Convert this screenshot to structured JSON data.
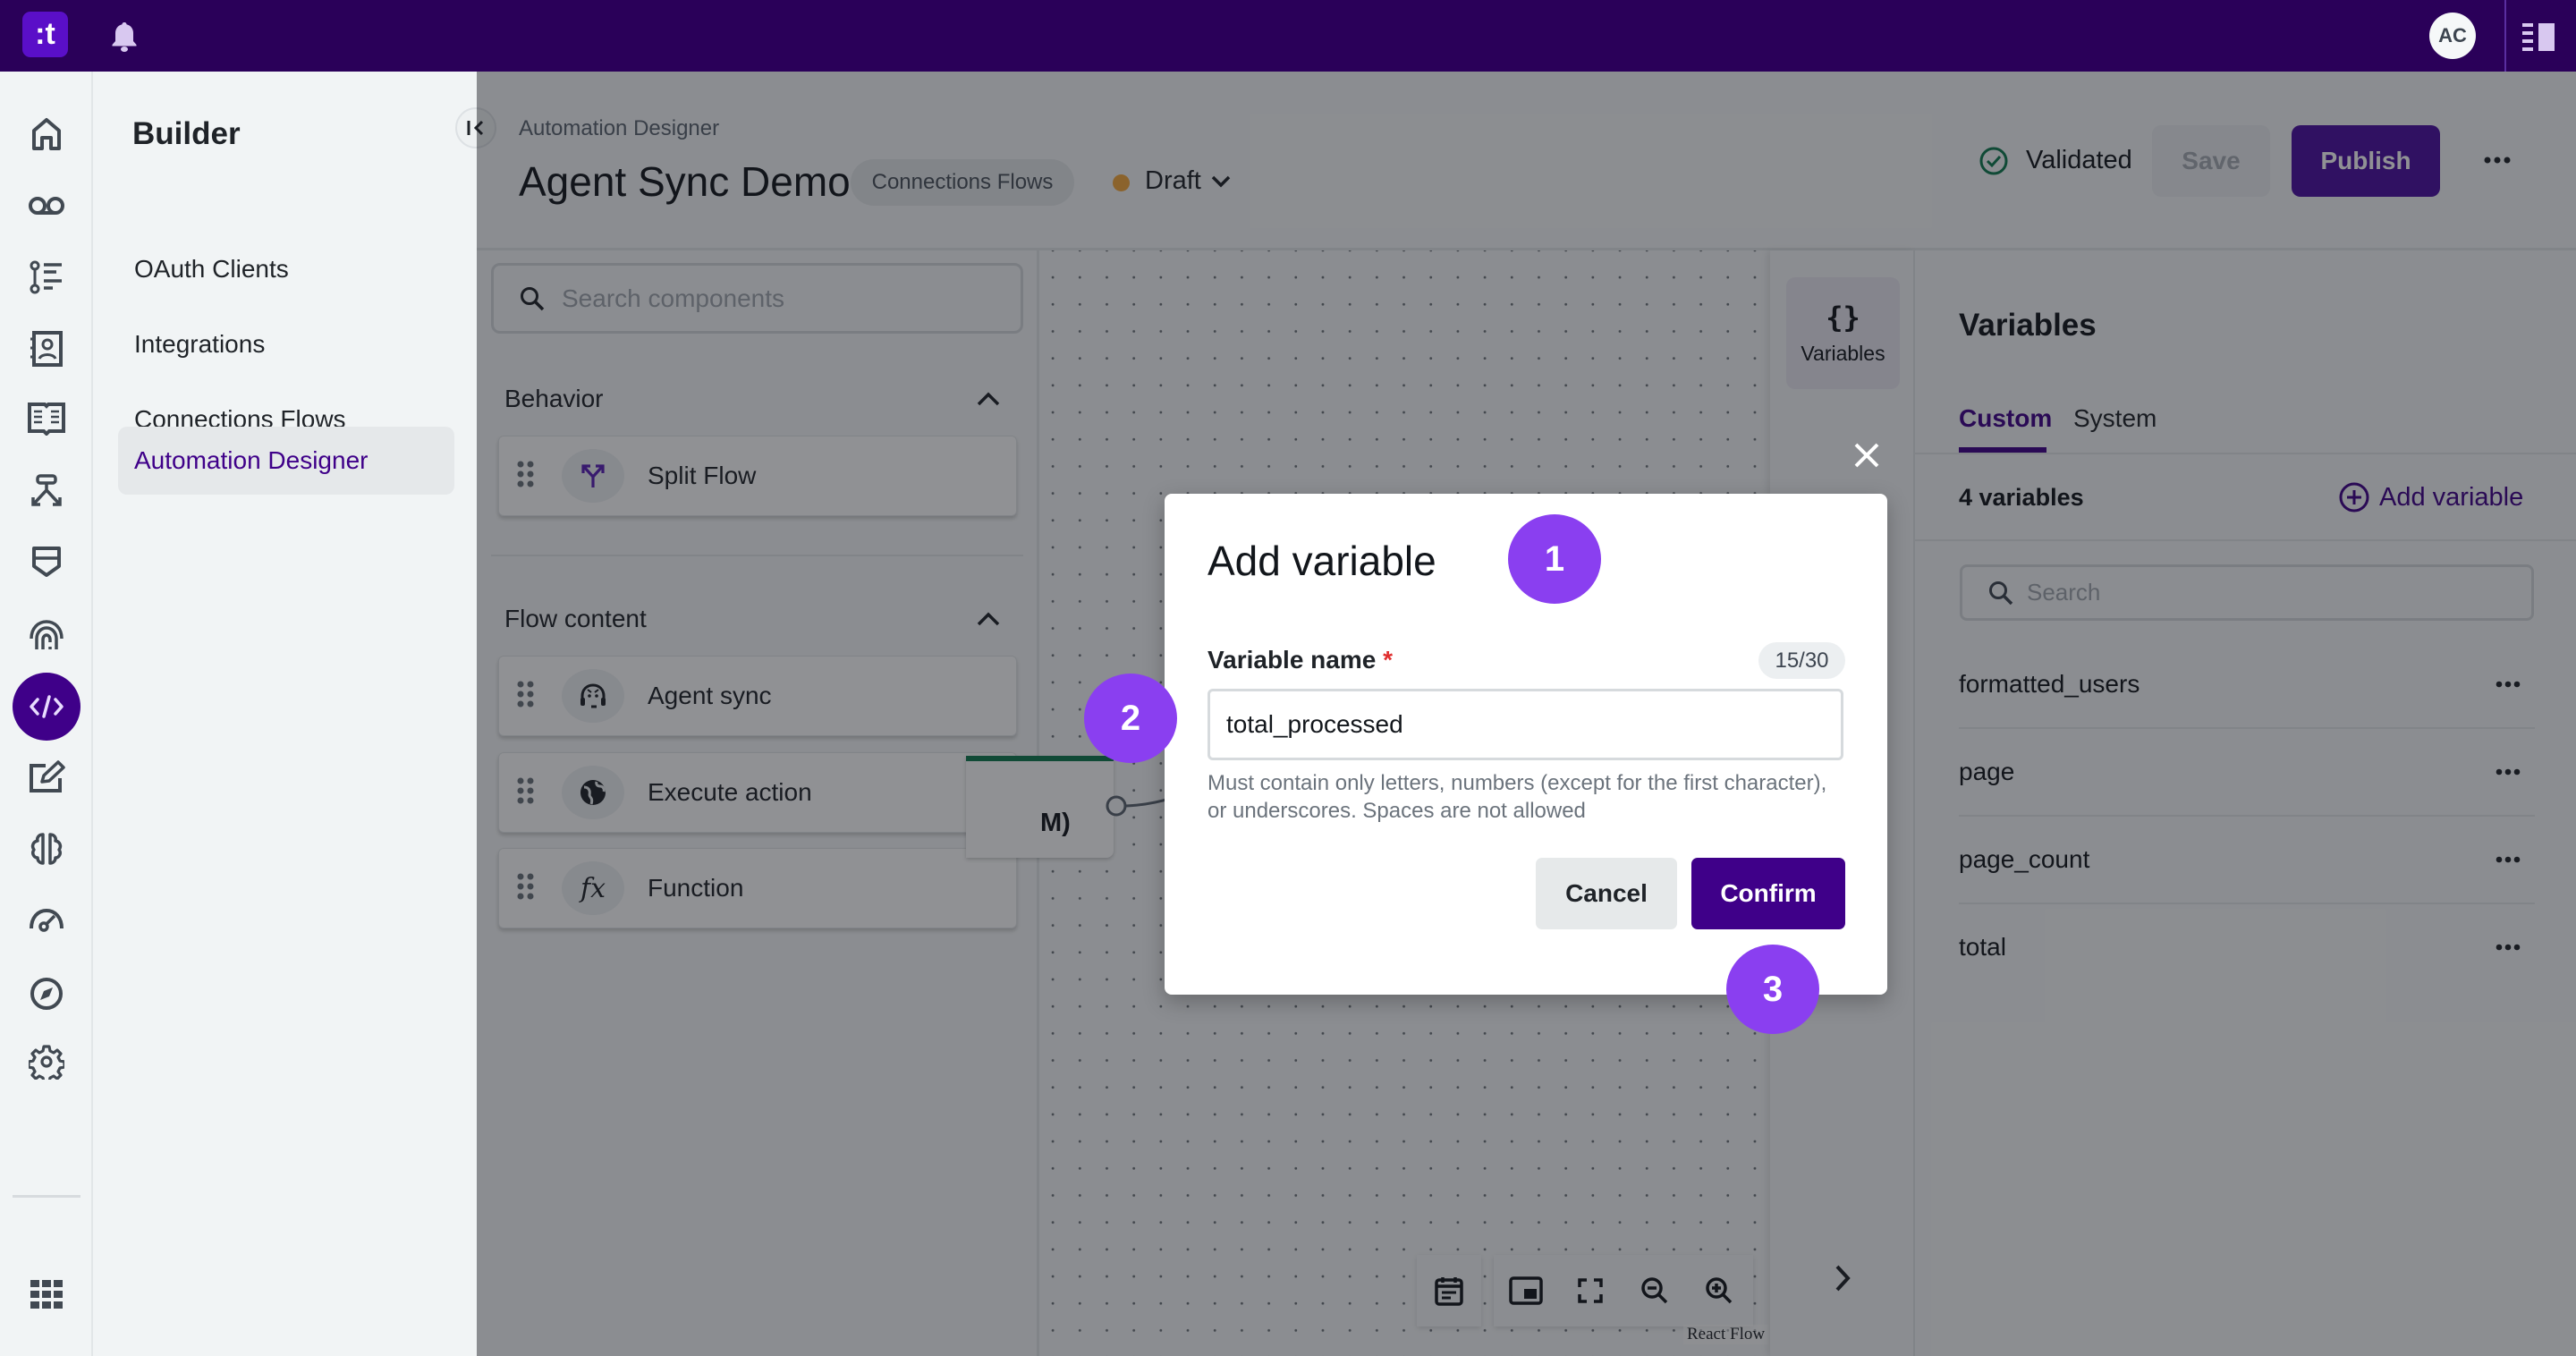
{
  "topbar": {
    "logo_text": ":t",
    "avatar_initials": "AC"
  },
  "builder": {
    "title": "Builder",
    "items": [
      {
        "label": "OAuth Clients",
        "active": false
      },
      {
        "label": "Integrations",
        "active": false
      },
      {
        "label": "Connections Flows",
        "active": false
      },
      {
        "label": "Automation Designer",
        "active": true
      }
    ]
  },
  "rail": {
    "icons": [
      "home-icon",
      "voicemail-icon",
      "timeline-list-icon",
      "contacts-icon",
      "book-icon",
      "connector-icon",
      "shield-icon",
      "fingerprint-icon",
      "code-icon",
      "edit-icon",
      "brain-icon",
      "gauge-icon",
      "compass-icon",
      "gear-icon",
      "apps-grid-icon"
    ],
    "active": "code-icon"
  },
  "header": {
    "breadcrumb": "Automation Designer",
    "title": "Agent Sync Demo",
    "chip": "Connections Flows",
    "status": "Draft",
    "status_color": "#f6a93b",
    "validated_label": "Validated",
    "save_label": "Save",
    "publish_label": "Publish"
  },
  "components": {
    "search_placeholder": "Search components",
    "sections": [
      {
        "title": "Behavior",
        "items": [
          {
            "label": "Split Flow",
            "icon": "split-icon"
          }
        ]
      },
      {
        "title": "Flow content",
        "items": [
          {
            "label": "Agent sync",
            "icon": "agent-headset-icon"
          },
          {
            "label": "Execute action",
            "icon": "globe-icon"
          },
          {
            "label": "Function",
            "icon": "function-icon"
          }
        ]
      }
    ]
  },
  "canvas": {
    "node_partial_text": "M)",
    "attribution": "React Flow"
  },
  "side_rail": {
    "variables_label": "Variables",
    "variables_glyph": "{}"
  },
  "variables_panel": {
    "title": "Variables",
    "tabs": [
      {
        "label": "Custom",
        "active": true
      },
      {
        "label": "System",
        "active": false
      }
    ],
    "count_label": "4 variables",
    "add_label": "Add variable",
    "search_placeholder": "Search",
    "items": [
      "formatted_users",
      "page",
      "page_count",
      "total"
    ]
  },
  "modal": {
    "title": "Add variable",
    "field_label": "Variable name",
    "required_mark": "*",
    "counter": "15/30",
    "value": "total_processed",
    "help_text": "Must contain only letters, numbers (except for the first character), or underscores. Spaces are not allowed",
    "cancel_label": "Cancel",
    "confirm_label": "Confirm"
  },
  "badges": [
    "1",
    "2",
    "3"
  ],
  "colors": {
    "topbar": "#2a0059",
    "brand": "#3f0089",
    "badge": "#8a3ff0",
    "validated": "#0e7a4f"
  }
}
